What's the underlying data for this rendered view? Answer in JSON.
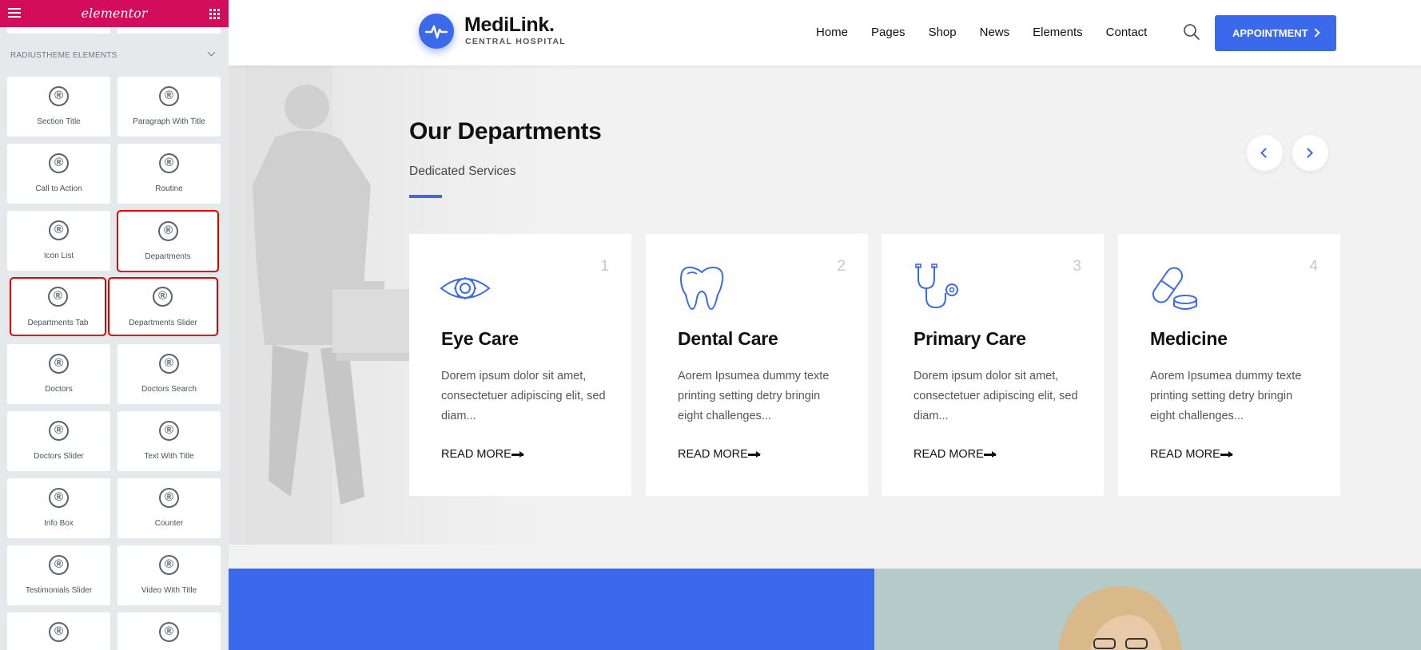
{
  "panel": {
    "logo_text": "elementor",
    "category_label": "RADIUSTHEME ELEMENTS",
    "icon_glyph": "®",
    "widgets": [
      "Section Title",
      "Paragraph With Title",
      "Call to Action",
      "Routine",
      "Icon List",
      "Departments",
      "Departments Tab",
      "Departments Slider",
      "Doctors",
      "Doctors Search",
      "Doctors Slider",
      "Text With Title",
      "Info Box",
      "Counter",
      "Testimonials Slider",
      "Video With Title",
      "",
      ""
    ],
    "highlight_color": "#e00000",
    "brand_color": "#d30c5c"
  },
  "site": {
    "brand": {
      "name": "MediLink.",
      "tagline": "CENTRAL HOSPITAL"
    },
    "nav": [
      "Home",
      "Pages",
      "Shop",
      "News",
      "Elements",
      "Contact"
    ],
    "appointment_label": "APPOINTMENT",
    "accent_color": "#3a69ec",
    "section": {
      "title": "Our Departments",
      "subtitle": "Dedicated Services"
    },
    "departments": [
      {
        "number": "1",
        "icon": "eye-icon",
        "title": "Eye Care",
        "description": "Dorem ipsum dolor sit amet, consectetuer adipiscing elit, sed diam...",
        "link": "READ MORE"
      },
      {
        "number": "2",
        "icon": "tooth-icon",
        "title": "Dental Care",
        "description": "Aorem Ipsumea dummy texte printing setting detry bringin eight challenges...",
        "link": "READ MORE"
      },
      {
        "number": "3",
        "icon": "stethoscope-icon",
        "title": "Primary Care",
        "description": "Dorem ipsum dolor sit amet, consectetuer adipiscing elit, sed diam...",
        "link": "READ MORE"
      },
      {
        "number": "4",
        "icon": "pill-icon",
        "title": "Medicine",
        "description": "Aorem Ipsumea dummy texte printing setting detry bringin eight challenges...",
        "link": "READ MORE"
      }
    ]
  }
}
